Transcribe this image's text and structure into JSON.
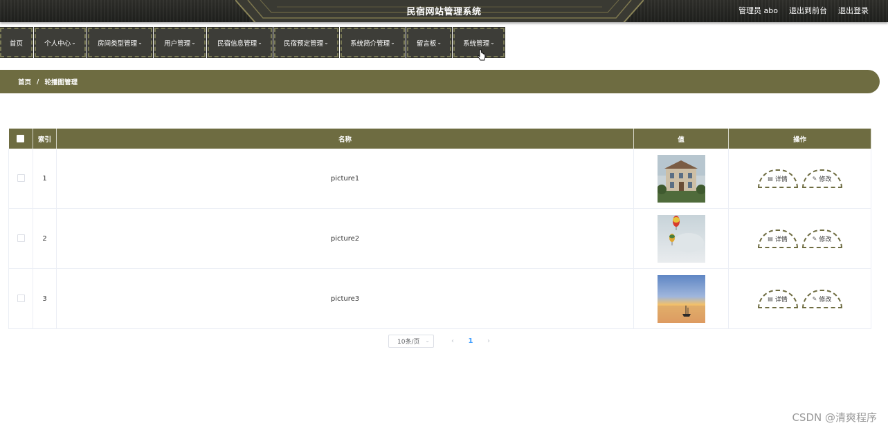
{
  "header": {
    "title": "民宿网站管理系统",
    "user_label": "管理员 abo",
    "to_front_label": "退出到前台",
    "logout_label": "退出登录"
  },
  "nav": {
    "items": [
      {
        "label": "首页",
        "has_dropdown": false
      },
      {
        "label": "个人中心",
        "has_dropdown": true
      },
      {
        "label": "房间类型管理",
        "has_dropdown": true
      },
      {
        "label": "用户管理",
        "has_dropdown": true
      },
      {
        "label": "民宿信息管理",
        "has_dropdown": true
      },
      {
        "label": "民宿预定管理",
        "has_dropdown": true
      },
      {
        "label": "系统简介管理",
        "has_dropdown": true
      },
      {
        "label": "留言板",
        "has_dropdown": true
      },
      {
        "label": "系统管理",
        "has_dropdown": true
      }
    ]
  },
  "breadcrumb": {
    "home": "首页",
    "separator": "/",
    "current": "轮播图管理"
  },
  "table": {
    "headers": {
      "index": "索引",
      "name": "名称",
      "value": "值",
      "actions": "操作"
    },
    "rows": [
      {
        "index": "1",
        "name": "picture1",
        "image": "house"
      },
      {
        "index": "2",
        "name": "picture2",
        "image": "balloons"
      },
      {
        "index": "3",
        "name": "picture3",
        "image": "sunset-boat"
      }
    ],
    "detail_label": "详情",
    "edit_label": "修改"
  },
  "pagination": {
    "page_size": "10条/页",
    "current_page": "1"
  },
  "watermark": "CSDN @清爽程序",
  "colors": {
    "accent": "#6e6c41",
    "nav_bg": "#3d3d38",
    "header_bg": "#24251f"
  }
}
